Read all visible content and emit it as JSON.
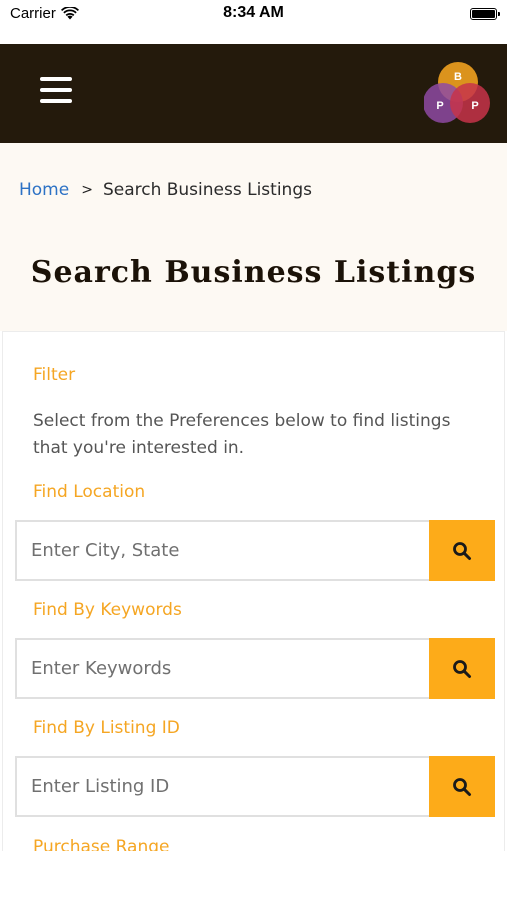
{
  "status_bar": {
    "carrier": "Carrier",
    "time": "8:34 AM"
  },
  "nav": {
    "logo_letters": [
      "B",
      "P",
      "P"
    ],
    "colors": {
      "background": "#241a0c",
      "logo_top": "#e69a1f",
      "logo_left": "#8e4aa3",
      "logo_right": "#c7344a"
    }
  },
  "breadcrumb": {
    "home": "Home",
    "separator": ">",
    "current": "Search Business Listings"
  },
  "page_title": "Search Business Listings",
  "filter": {
    "heading": "Filter",
    "description": "Select from the Preferences below to find listings that you're interested in.",
    "location": {
      "label": "Find Location",
      "placeholder": "Enter City, State"
    },
    "keywords": {
      "label": "Find By Keywords",
      "placeholder": "Enter Keywords"
    },
    "listing_id": {
      "label": "Find By Listing ID",
      "placeholder": "Enter Listing ID"
    },
    "next_label": "Purchase Range"
  },
  "colors": {
    "accent": "#f5a623",
    "button": "#fdab19",
    "link": "#2d72c5"
  }
}
